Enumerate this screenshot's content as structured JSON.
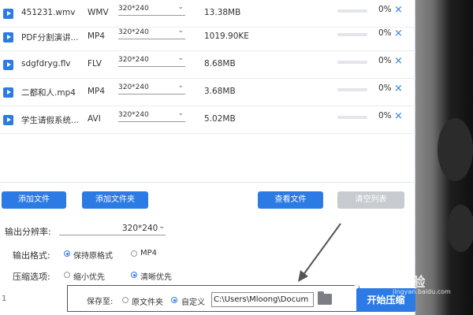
{
  "files": [
    {
      "name": "451231.wmv",
      "type": "WMV",
      "resolution": "320*240",
      "size": "13.38MB",
      "progress_pct": 0,
      "progress_label": "0%"
    },
    {
      "name": "PDF分割演讲...",
      "type": "MP4",
      "resolution": "320*240",
      "size": "1019.90KE",
      "progress_pct": 0,
      "progress_label": "0%"
    },
    {
      "name": "sdgfdryg.flv",
      "type": "FLV",
      "resolution": "320*240",
      "size": "8.68MB",
      "progress_pct": 0,
      "progress_label": "0%"
    },
    {
      "name": "二都和人.mp4",
      "type": "MP4",
      "resolution": "320*240",
      "size": "3.68MB",
      "progress_pct": 0,
      "progress_label": "0%"
    },
    {
      "name": "学生请假系统...",
      "type": "AVI",
      "resolution": "320*240",
      "size": "5.02MB",
      "progress_pct": 0,
      "progress_label": "0%"
    }
  ],
  "icons": {
    "file": "video-file-icon",
    "delete": "close-icon",
    "dropdown": "chevron-down-icon",
    "folder": "folder-icon"
  },
  "delete_glyph": "×",
  "dropdown_glyph": "⌄",
  "toolbar": {
    "add_file": "添加文件",
    "add_folder": "添加文件夹",
    "view_file": "查看文件",
    "clear_list": "清空列表"
  },
  "settings": {
    "resolution_label": "输出分辨率:",
    "resolution_value": "320*240",
    "format_label": "输出格式:",
    "format_options": [
      "保持原格式",
      "MP4"
    ],
    "format_selected": "保持原格式",
    "compress_label": "压缩选项:",
    "compress_options": [
      "缩小优先",
      "清晰优先"
    ],
    "compress_selected": "清晰优先"
  },
  "save": {
    "label": "保存至:",
    "options": [
      "原文件夹",
      "自定义"
    ],
    "selected": "自定义",
    "path": "C:\\Users\\Mloong\\Docum"
  },
  "page_number": "1",
  "start_button": "开始压缩",
  "watermark": {
    "main": "Baidu经验",
    "sub": "jingyan.baidu.com"
  },
  "colors": {
    "accent": "#2c7be5",
    "disabled": "#c8cbcf"
  }
}
